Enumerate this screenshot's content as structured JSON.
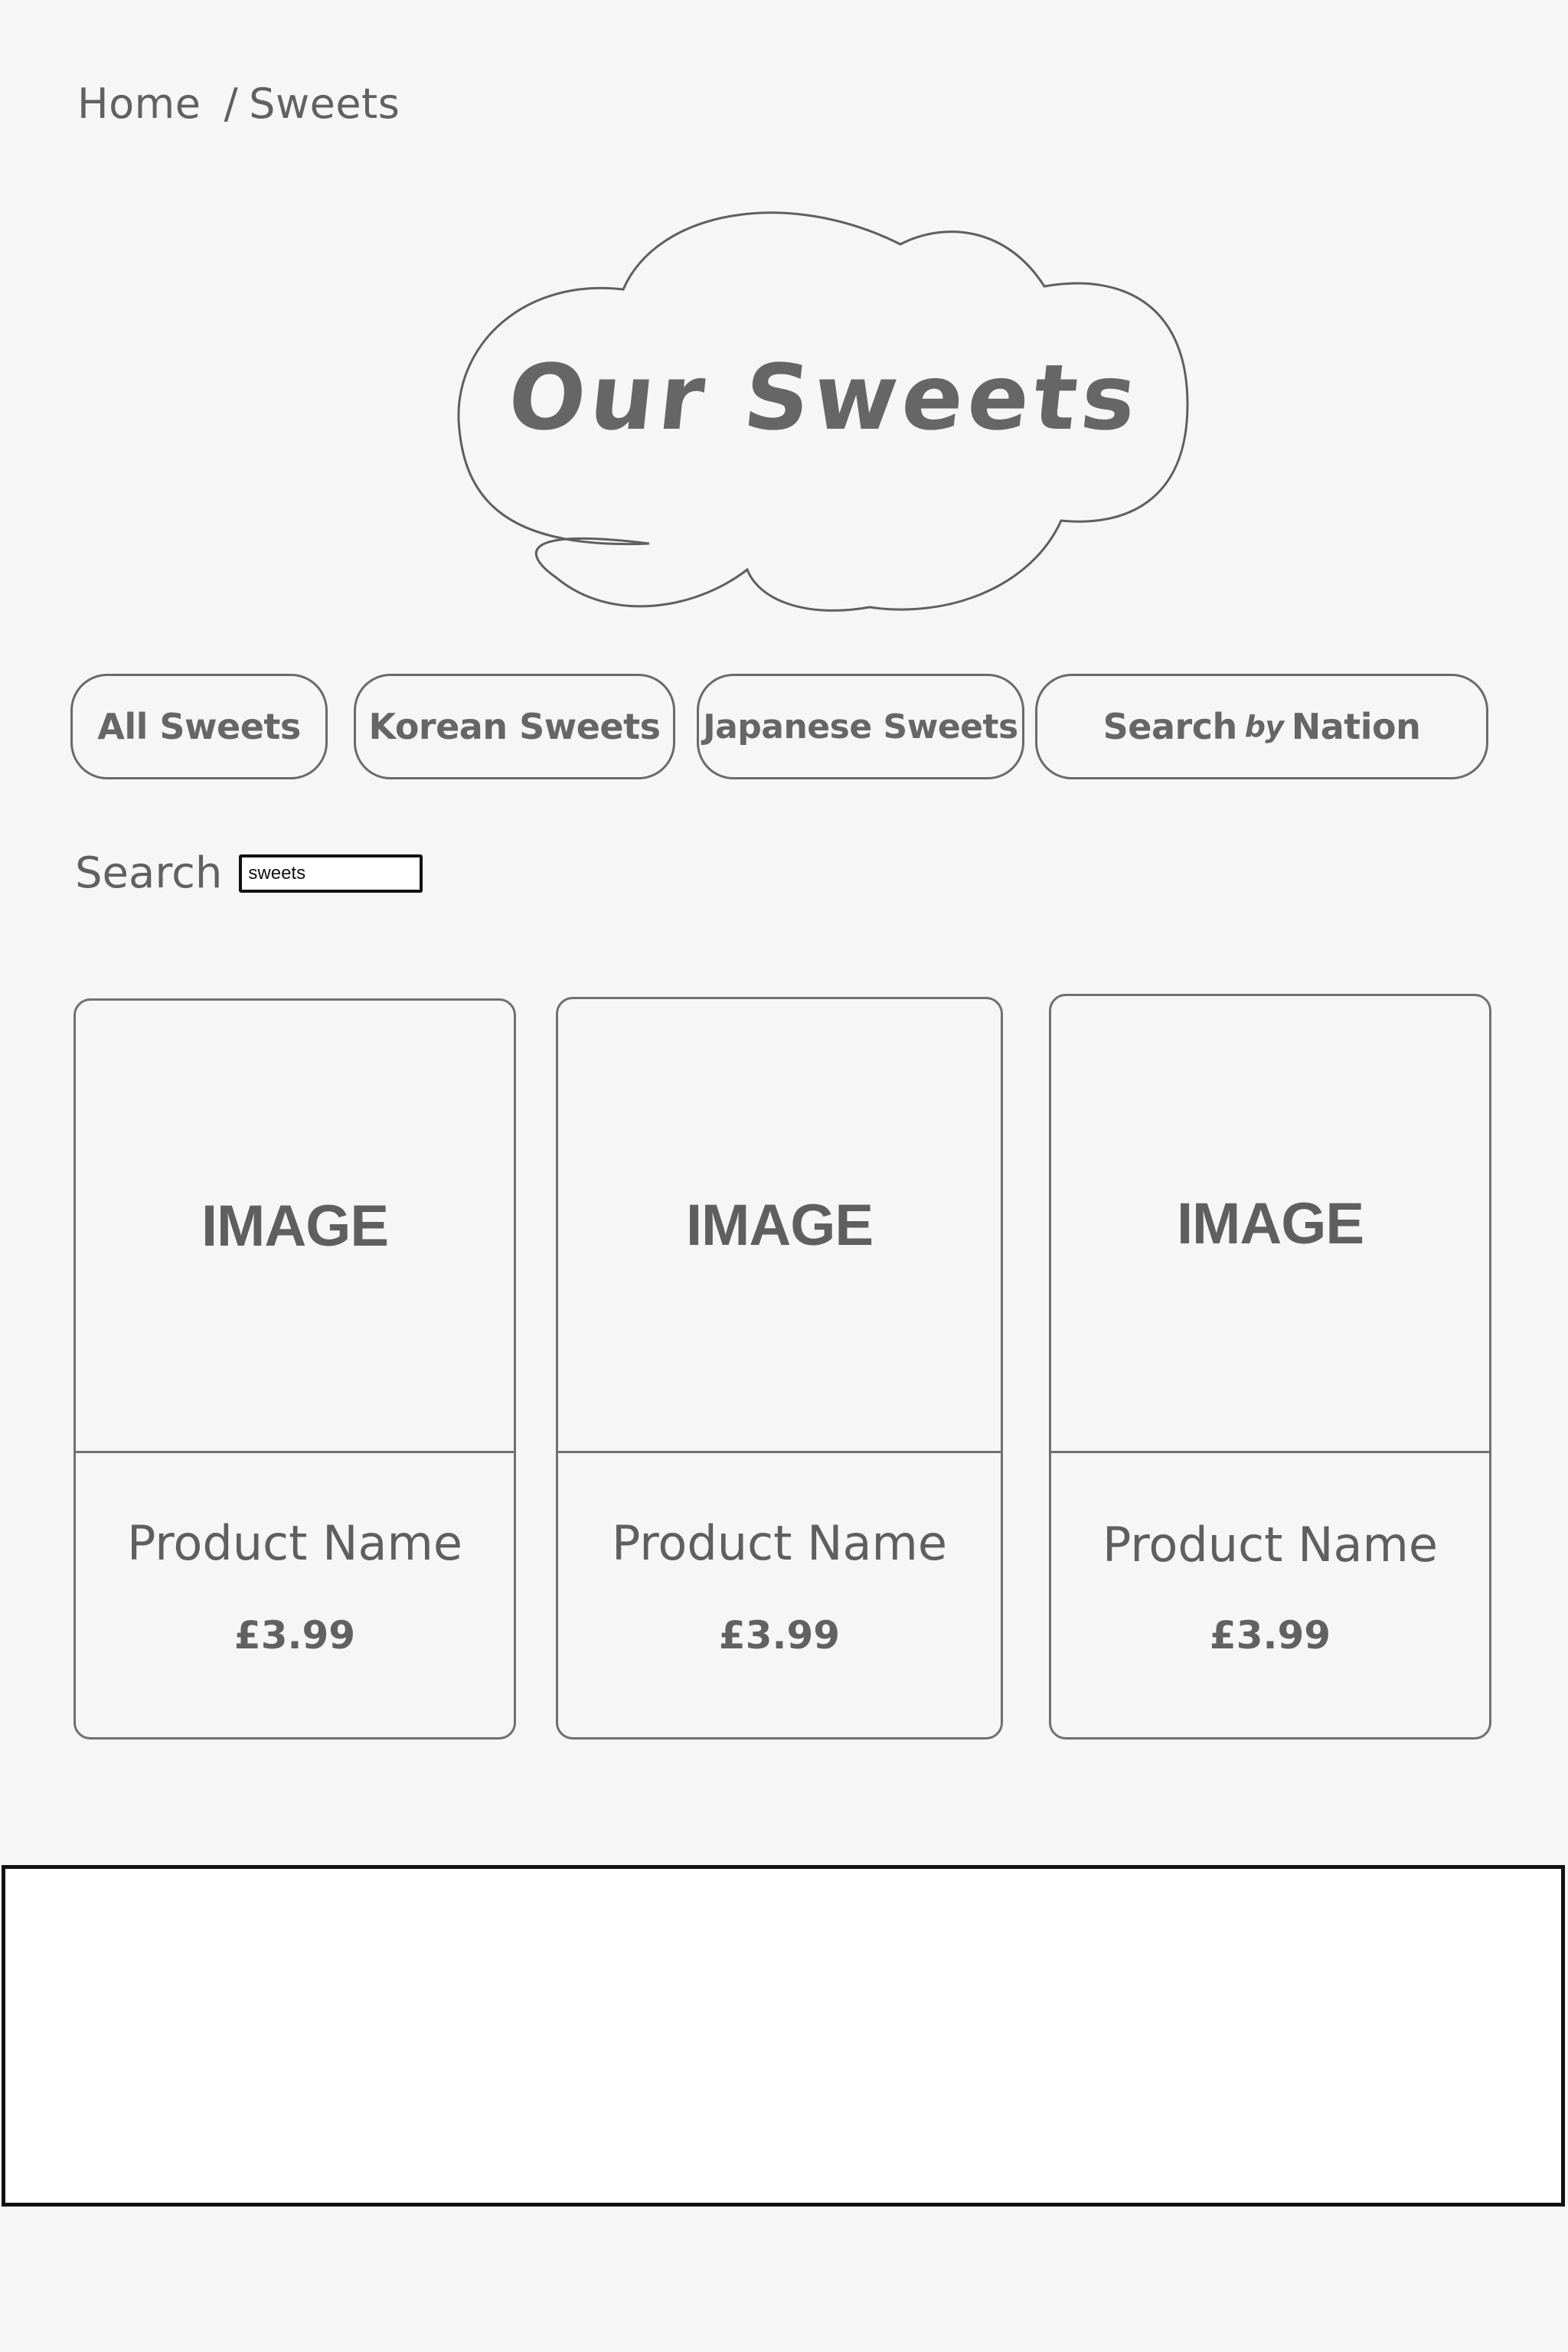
{
  "breadcrumb": {
    "home": "Home",
    "separator": "/",
    "current": "Sweets"
  },
  "heading": {
    "title": "Our Sweets"
  },
  "filters": {
    "all": "All Sweets",
    "korean": "Korean Sweets",
    "japanese": "Japanese Sweets",
    "nation": {
      "part1": "Search",
      "part2": "by",
      "part3": "Nation"
    }
  },
  "search": {
    "label": "Search",
    "value": "sweets"
  },
  "products": [
    {
      "image_label": "IMAGE",
      "name": "Product Name",
      "price": "£3.99"
    },
    {
      "image_label": "IMAGE",
      "name": "Product Name",
      "price": "£3.99"
    },
    {
      "image_label": "IMAGE",
      "name": "Product Name",
      "price": "£3.99"
    }
  ],
  "colors": {
    "background": "#f6f6f6",
    "outline": "#6a6a6a",
    "text": "#616161",
    "footer_border": "#111111"
  }
}
